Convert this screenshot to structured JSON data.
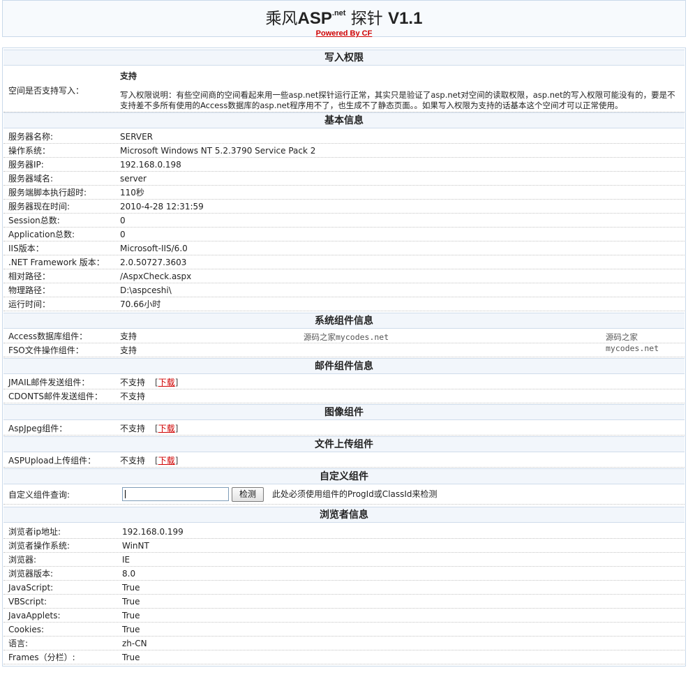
{
  "header": {
    "title_prefix": "乘风",
    "title_asp": "ASP",
    "title_sup": ".net",
    "title_suffix": " 探针 ",
    "title_version": "V1.1",
    "powered_by": "Powered By CF"
  },
  "write": {
    "section_title": "写入权限",
    "label": "空间是否支持写入：",
    "status": "支持",
    "description": "写入权限说明：有些空间商的空间看起来用一些asp.net探针运行正常，其实只是验证了asp.net对空间的读取权限，asp.net的写入权限可能没有的，要是不支持差不多所有使用的Access数据库的asp.net程序用不了，也生成不了静态页面。。如果写入权限为支持的话基本这个空间才可以正常使用。"
  },
  "basic": {
    "section_title": "基本信息",
    "rows": [
      {
        "label": "服务器名称:",
        "value": "SERVER"
      },
      {
        "label": "操作系统：",
        "value": "Microsoft Windows NT 5.2.3790 Service Pack 2"
      },
      {
        "label": "服务器IP:",
        "value": "192.168.0.198"
      },
      {
        "label": "服务器域名:",
        "value": "server"
      },
      {
        "label": "服务端脚本执行超时:",
        "value": "110秒"
      },
      {
        "label": "服务器现在时间:",
        "value": "2010-4-28 12:31:59"
      },
      {
        "label": "Session总数:",
        "value": "0"
      },
      {
        "label": "Application总数:",
        "value": "0"
      },
      {
        "label": "IIS版本：",
        "value": "Microsoft-IIS/6.0"
      },
      {
        "label": ".NET Framework 版本：",
        "value": "2.0.50727.3603"
      },
      {
        "label": "相对路径：",
        "value": "/AspxCheck.aspx"
      },
      {
        "label": "物理路径：",
        "value": "D:\\aspceshi\\"
      },
      {
        "label": "运行时间：",
        "value": "70.66小时"
      }
    ]
  },
  "system": {
    "section_title": "系统组件信息",
    "rows": [
      {
        "label": "Access数据库组件：",
        "value": "支持"
      },
      {
        "label": "FSO文件操作组件：",
        "value": "支持"
      }
    ],
    "watermark": "源码之家mycodes.net"
  },
  "mail": {
    "section_title": "邮件组件信息",
    "rows": [
      {
        "label": "JMAIL邮件发送组件：",
        "value": "不支持",
        "download": "下载"
      },
      {
        "label": "CDONTS邮件发送组件：",
        "value": "不支持"
      }
    ]
  },
  "image": {
    "section_title": "图像组件",
    "rows": [
      {
        "label": "AspJpeg组件：",
        "value": "不支持",
        "download": "下载"
      }
    ]
  },
  "upload": {
    "section_title": "文件上传组件",
    "rows": [
      {
        "label": "ASPUpload上传组件：",
        "value": "不支持",
        "download": "下载"
      }
    ]
  },
  "custom": {
    "section_title": "自定义组件",
    "label": "自定义组件查询:",
    "input_value": "",
    "button_label": "检测",
    "note": "此处必须使用组件的ProgId或ClassId来检测"
  },
  "browser": {
    "section_title": "浏览者信息",
    "rows": [
      {
        "label": "浏览者ip地址:",
        "value": "192.168.0.199"
      },
      {
        "label": "浏览者操作系统:",
        "value": "WinNT"
      },
      {
        "label": "浏览器:",
        "value": "IE"
      },
      {
        "label": "浏览器版本:",
        "value": "8.0"
      },
      {
        "label": "JavaScript:",
        "value": "True"
      },
      {
        "label": "VBScript:",
        "value": "True"
      },
      {
        "label": "JavaApplets:",
        "value": "True"
      },
      {
        "label": "Cookies:",
        "value": "True"
      },
      {
        "label": "语言:",
        "value": "zh-CN"
      },
      {
        "label": "Frames（分栏）:",
        "value": "True"
      }
    ]
  },
  "colors": {
    "section_bg": "#f2f6fb",
    "border": "#c9d9ea",
    "link_red": "#d00000"
  }
}
